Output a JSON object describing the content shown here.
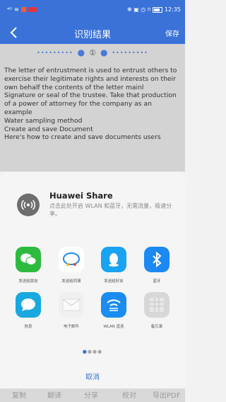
{
  "status": {
    "time": "12:35",
    "signal": "⁴ᴳ",
    "wifi": "≋"
  },
  "header": {
    "title": "识别结果",
    "save_label": "保存",
    "page_number": "①"
  },
  "content": {
    "lines": [
      "The letter of entrustment is used to entrust others to exercise their legitimate rights and interests on their own behalf the contents of the letter mainl",
      "Signature or seal of the trustee. Take that production of a power of attorney for the company as an example",
      "Water sampling method",
      "Create and save Document",
      "Here's how to create and save documents users"
    ]
  },
  "share": {
    "title": "Huawei Share",
    "description": "点击此处开启 WLAN 和蓝牙，无需流量，极速分享。",
    "apps": [
      {
        "label": "发送给朋友",
        "icon": "wechat-icon",
        "color": "#2dbb3f"
      },
      {
        "label": "发送给同事",
        "icon": "work-chat-icon",
        "color": "#ffffff"
      },
      {
        "label": "发送给好友",
        "icon": "qq-icon",
        "color": "#1aa2f3"
      },
      {
        "label": "蓝牙",
        "icon": "bluetooth-icon",
        "color": "#1c88f2"
      },
      {
        "label": "信息",
        "icon": "message-icon",
        "color": "#19a8df"
      },
      {
        "label": "电子邮件",
        "icon": "mail-icon",
        "color": "#f0f0f0"
      },
      {
        "label": "WLAN 直连",
        "icon": "wifi-direct-icon",
        "color": "#1b8cf2"
      },
      {
        "label": "备忘录",
        "icon": "memo-icon",
        "color": "#d7d7d7"
      }
    ],
    "cancel_label": "取消"
  },
  "bottom_bar": {
    "items": [
      "复制",
      "翻译",
      "分享",
      "校对",
      "导出PDF"
    ]
  },
  "colors": {
    "primary": "#3a72d8"
  }
}
